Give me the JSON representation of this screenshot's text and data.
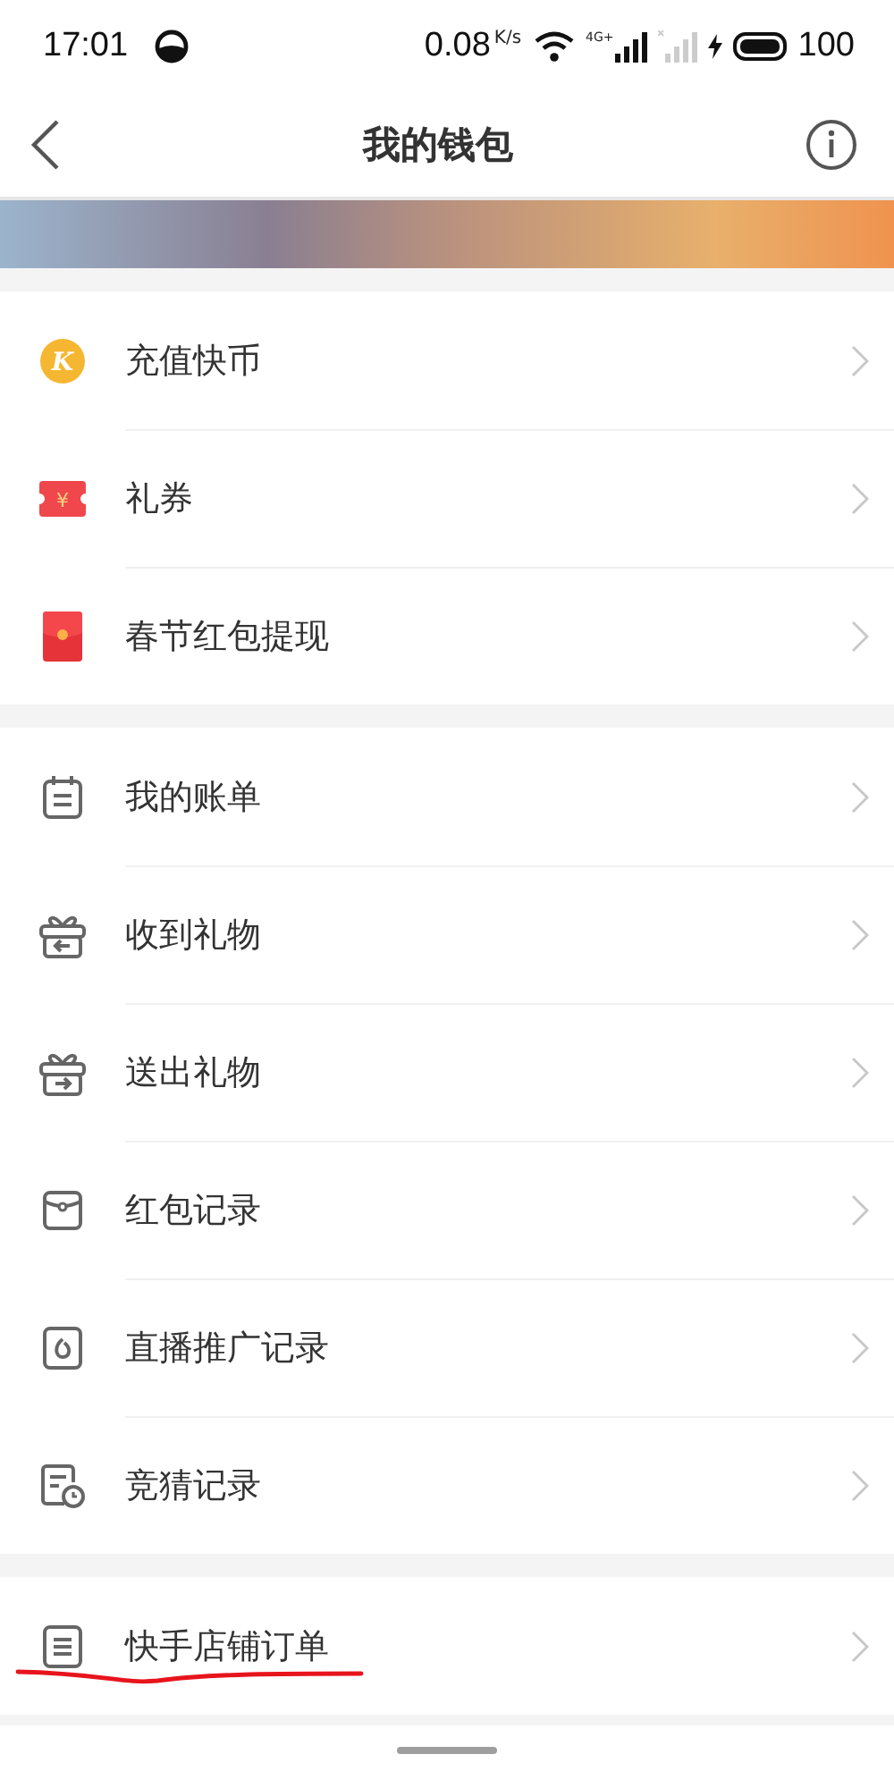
{
  "status_bar": {
    "time": "17:01",
    "speed": "0.08",
    "speed_unit": "K/s",
    "network": "4G+",
    "battery": "100"
  },
  "nav": {
    "title": "我的钱包"
  },
  "groups": [
    {
      "items": [
        {
          "kind": "coin",
          "label": "充值快币",
          "icon_text": "K",
          "marked": false
        },
        {
          "kind": "ticket",
          "label": "礼券",
          "icon_text": "¥",
          "marked": false
        },
        {
          "kind": "redpacket",
          "label": "春节红包提现",
          "marked": false
        }
      ]
    },
    {
      "items": [
        {
          "kind": "bill",
          "label": "我的账单",
          "marked": false
        },
        {
          "kind": "gift-in",
          "label": "收到礼物",
          "marked": false
        },
        {
          "kind": "gift-out",
          "label": "送出礼物",
          "marked": false
        },
        {
          "kind": "envelope",
          "label": "红包记录",
          "marked": false
        },
        {
          "kind": "promo",
          "label": "直播推广记录",
          "marked": false
        },
        {
          "kind": "guess",
          "label": "竞猜记录",
          "marked": false
        }
      ]
    },
    {
      "items": [
        {
          "kind": "order",
          "label": "快手店铺订单",
          "marked": true
        }
      ]
    }
  ]
}
